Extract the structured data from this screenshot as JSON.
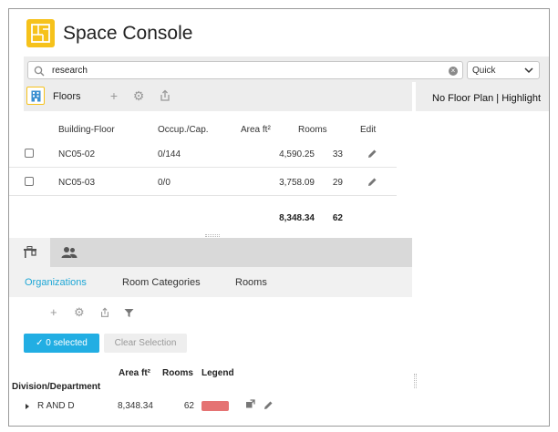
{
  "app": {
    "title": "Space Console"
  },
  "colors": {
    "accent": "#1ea7d6",
    "brand": "#f6c21b",
    "legend": "#e57373"
  },
  "search": {
    "value": "research",
    "mode": "Quick"
  },
  "floors": {
    "label": "Floors",
    "columns": [
      "Building-Floor",
      "Occup./Cap.",
      "Area ft²",
      "Rooms",
      "Edit"
    ],
    "rows": [
      {
        "floor": "NC05-02",
        "occupancy": "0/144",
        "area": "4,590.25",
        "rooms": "33"
      },
      {
        "floor": "NC05-03",
        "occupancy": "0/0",
        "area": "3,758.09",
        "rooms": "29"
      }
    ],
    "totals": {
      "area": "8,348.34",
      "rooms": "62"
    }
  },
  "right_panel": {
    "text": "No Floor Plan | Highlight"
  },
  "tabs": [
    "Organizations",
    "Room Categories",
    "Rooms"
  ],
  "org": {
    "selected_label": "0 selected",
    "clear_label": "Clear Selection",
    "columns": {
      "division": "Division/Department",
      "area": "Area ft²",
      "rooms": "Rooms",
      "legend": "Legend"
    },
    "rows": [
      {
        "name": "R AND D",
        "area": "8,348.34",
        "rooms": "62"
      }
    ]
  }
}
